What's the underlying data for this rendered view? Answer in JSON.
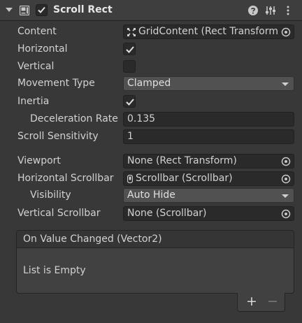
{
  "component": {
    "title": "Scroll Rect",
    "enabled": true,
    "icons": [
      "fold-triangle-icon",
      "scrollrect-component-icon",
      "help-icon",
      "preset-icon",
      "kebab-menu-icon"
    ]
  },
  "fields": {
    "content": {
      "label": "Content",
      "value": "GridContent (Rect Transform)",
      "icon": "rect-transform-icon"
    },
    "horizontal": {
      "label": "Horizontal",
      "checked": true
    },
    "vertical": {
      "label": "Vertical",
      "checked": false
    },
    "movement_type": {
      "label": "Movement Type",
      "value": "Clamped"
    },
    "inertia": {
      "label": "Inertia",
      "checked": true
    },
    "deceleration_rate": {
      "label": "Deceleration Rate",
      "value": "0.135"
    },
    "scroll_sensitivity": {
      "label": "Scroll Sensitivity",
      "value": "1"
    },
    "viewport": {
      "label": "Viewport",
      "value": "None (Rect Transform)"
    },
    "horizontal_scrollbar": {
      "label": "Horizontal Scrollbar",
      "value": "Scrollbar (Scrollbar)",
      "icon": "scrollbar-icon"
    },
    "visibility": {
      "label": "Visibility",
      "value": "Auto Hide"
    },
    "vertical_scrollbar": {
      "label": "Vertical Scrollbar",
      "value": "None (Scrollbar)"
    }
  },
  "event": {
    "title": "On Value Changed (Vector2)",
    "empty_text": "List is Empty",
    "add_label": "+",
    "remove_label": "−"
  },
  "colors": {
    "background": "#383838",
    "header": "#3e3e3e",
    "field": "#2a2a2a",
    "dropdown": "#515151",
    "text": "#d2d2d2"
  }
}
